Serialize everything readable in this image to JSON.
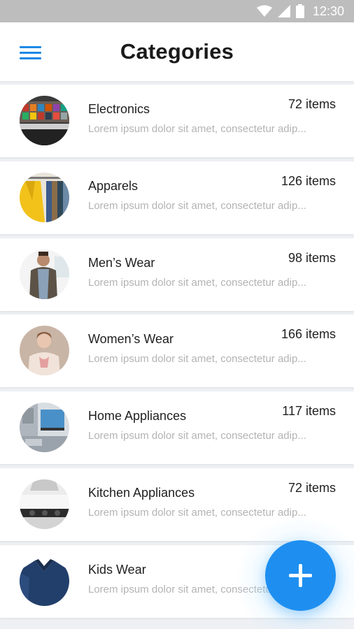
{
  "status_bar": {
    "time": "12:30"
  },
  "header": {
    "title": "Categories"
  },
  "categories": [
    {
      "name": "Electronics",
      "count": "72 items",
      "description": "Lorem ipsum dolor sit amet, consectetur adip...",
      "image": "electronics-store-image"
    },
    {
      "name": "Apparels",
      "count": "126 items",
      "description": "Lorem ipsum dolor sit amet, consectetur adip...",
      "image": "clothes-rack-image"
    },
    {
      "name": "Men’s Wear",
      "count": "98 items",
      "description": "Lorem ipsum dolor sit amet, consectetur adip...",
      "image": "man-portrait-image"
    },
    {
      "name": "Women’s Wear",
      "count": "166 items",
      "description": "Lorem ipsum dolor sit amet, consectetur adip...",
      "image": "woman-portrait-image"
    },
    {
      "name": "Home Appliances",
      "count": "117 items",
      "description": "Lorem ipsum dolor sit amet, consectetur adip...",
      "image": "home-appliances-image"
    },
    {
      "name": "Kitchen Appliances",
      "count": "72 items",
      "description": "Lorem ipsum dolor sit amet, consectetur adip...",
      "image": "kitchen-image"
    },
    {
      "name": "Kids Wear",
      "count": "",
      "description": "Lorem ipsum dolor sit amet, consectetur adip...",
      "image": "kids-sweater-image"
    }
  ],
  "fab": {
    "icon": "plus-icon"
  },
  "colors": {
    "accent": "#1e8ff0",
    "menu": "#1e88e5",
    "status_bar": "#bdbdbd",
    "muted_text": "#b3b3b3"
  }
}
